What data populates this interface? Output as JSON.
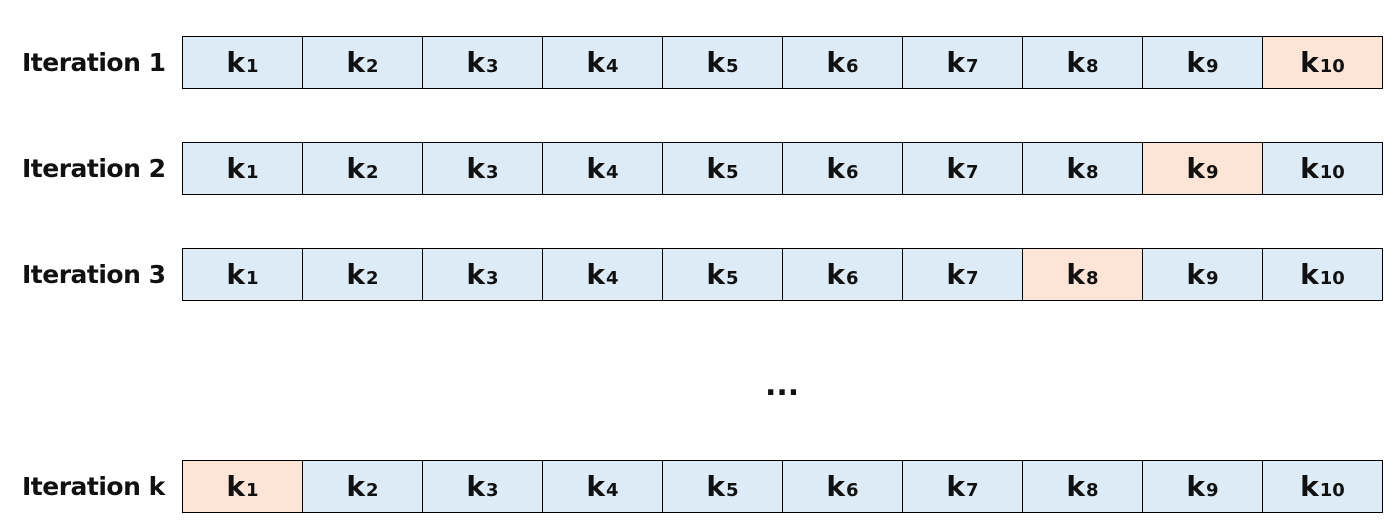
{
  "fold_symbol": "k",
  "ellipsis": "...",
  "colors": {
    "train": "#DDEBF7",
    "test": "#FCE4D6",
    "border": "#000000"
  },
  "iterations": [
    {
      "label": "Iteration 1",
      "folds": [
        "1",
        "2",
        "3",
        "4",
        "5",
        "6",
        "7",
        "8",
        "9",
        "10"
      ],
      "test_fold": "10"
    },
    {
      "label": "Iteration 2",
      "folds": [
        "1",
        "2",
        "3",
        "4",
        "5",
        "6",
        "7",
        "8",
        "9",
        "10"
      ],
      "test_fold": "9"
    },
    {
      "label": "Iteration 3",
      "folds": [
        "1",
        "2",
        "3",
        "4",
        "5",
        "6",
        "7",
        "8",
        "9",
        "10"
      ],
      "test_fold": "8"
    },
    {
      "label": "Iteration k",
      "folds": [
        "1",
        "2",
        "3",
        "4",
        "5",
        "6",
        "7",
        "8",
        "9",
        "10"
      ],
      "test_fold": "1"
    }
  ]
}
